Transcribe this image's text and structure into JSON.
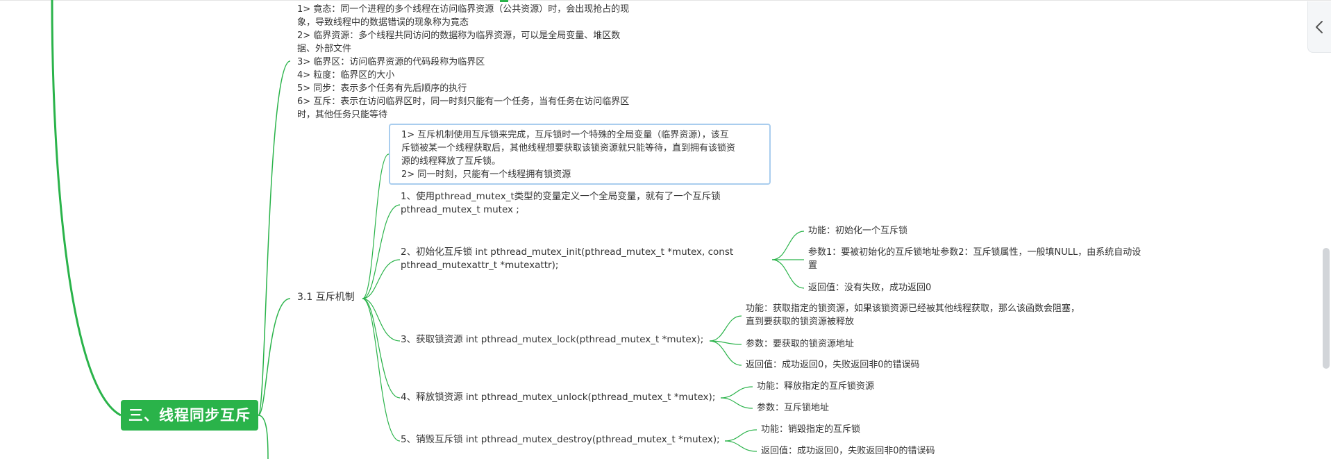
{
  "mindmap": {
    "root": {
      "label": "三、线程同步互斥"
    },
    "concepts": [
      "1> 竟态：同一个进程的多个线程在访问临界资源（公共资源）时，会出现抢占的现",
      "象，导致线程中的数据错误的现象称为竟态",
      "2> 临界资源：多个线程共同访问的数据称为临界资源，可以是全局变量、堆区数",
      "据、外部文件",
      "3> 临界区：访问临界资源的代码段称为临界区",
      "4> 粒度：临界区的大小",
      "5> 同步：表示多个任务有先后顺序的执行",
      "6> 互斥：表示在访问临界区时，同一时刻只能有一个任务，当有任务在访问临界区",
      "时，其他任务只能等待"
    ],
    "section": {
      "label": "3.1 互斥机制",
      "note": [
        "1> 互斥机制使用互斥锁来完成，互斥锁时一个特殊的全局变量（临界资源），该互",
        "斥锁被某一个线程获取后，其他线程想要获取该锁资源就只能等待，直到拥有该锁资",
        "源的线程释放了互斥锁。",
        "2> 同一时刻，只能有一个线程拥有锁资源"
      ],
      "steps": [
        {
          "lines": [
            "1、使用pthread_mutex_t类型的变量定义一个全局变量，就有了一个互斥锁",
            "pthread_mutex_t mutex ;"
          ],
          "details": []
        },
        {
          "lines": [
            "2、初始化互斥锁 int pthread_mutex_init(pthread_mutex_t *mutex, const",
            "pthread_mutexattr_t *mutexattr);"
          ],
          "details": [
            [
              "功能：初始化一个互斥锁"
            ],
            [
              "参数1：要被初始化的互斥锁地址参数2：互斥锁属性，一般填NULL，由系统自动设",
              "置"
            ],
            [
              "返回值：没有失败，成功返回0"
            ]
          ]
        },
        {
          "lines": [
            "3、获取锁资源 int pthread_mutex_lock(pthread_mutex_t *mutex);"
          ],
          "details": [
            [
              "功能：获取指定的锁资源，如果该锁资源已经被其他线程获取，那么该函数会阻塞，",
              "直到要获取的锁资源被释放"
            ],
            [
              "参数：要获取的锁资源地址"
            ],
            [
              "返回值：成功返回0，失败返回非0的错误码"
            ]
          ]
        },
        {
          "lines": [
            "4、释放锁资源 int pthread_mutex_unlock(pthread_mutex_t *mutex);"
          ],
          "details": [
            [
              "功能：释放指定的互斥锁资源"
            ],
            [
              "参数：互斥锁地址"
            ]
          ]
        },
        {
          "lines": [
            "5、销毁互斥锁 int pthread_mutex_destroy(pthread_mutex_t *mutex);"
          ],
          "details": [
            [
              "功能：销毁指定的互斥锁"
            ],
            [
              "返回值：成功返回0，失败返回非0的错误码"
            ]
          ]
        }
      ]
    }
  },
  "colors": {
    "branch": "#2ab34a",
    "note_border": "#a9cdee",
    "text": "#333333"
  },
  "icons": {
    "panel_toggle": "chevron-left-icon"
  }
}
